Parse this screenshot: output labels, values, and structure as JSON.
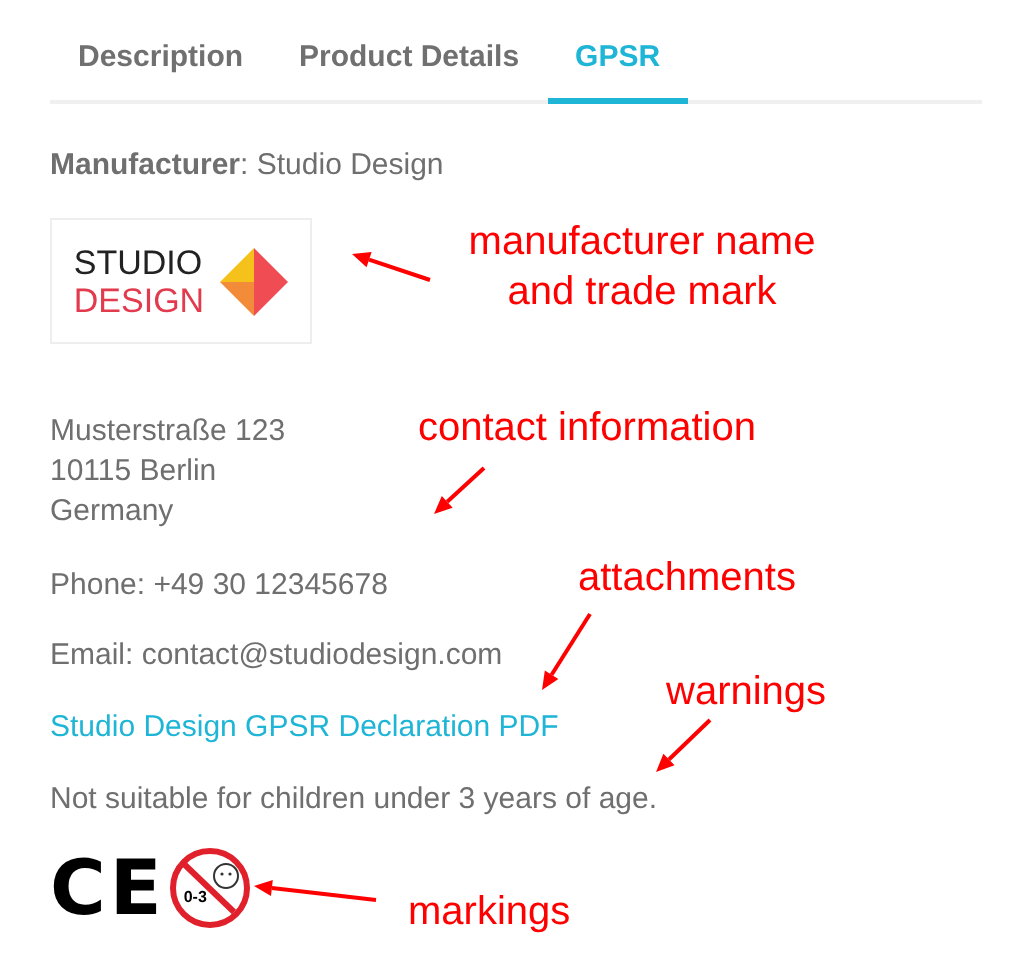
{
  "tabs": [
    {
      "label": "Description",
      "selected": false
    },
    {
      "label": "Product Details",
      "selected": false
    },
    {
      "label": "GPSR",
      "selected": true
    }
  ],
  "manufacturer": {
    "label": "Manufacturer",
    "separator": ": ",
    "name": "Studio Design",
    "logo": {
      "line_1": "STUDIO",
      "line_2": "DESIGN"
    }
  },
  "address": [
    "Musterstraße 123",
    "10115 Berlin",
    "Germany"
  ],
  "phone": "Phone: +49 30 12345678",
  "email": "Email: contact@studiodesign.com",
  "attachment_link": "Studio Design GPSR Declaration PDF",
  "warning": "Not suitable for children under 3 years of age.",
  "markings": [
    {
      "kind": "ce",
      "text": "CE"
    },
    {
      "kind": "age",
      "text": "0-3"
    }
  ],
  "annotations": [
    "manufacturer name\nand trade mark",
    "contact information",
    "attachments",
    "warnings",
    "markings"
  ]
}
